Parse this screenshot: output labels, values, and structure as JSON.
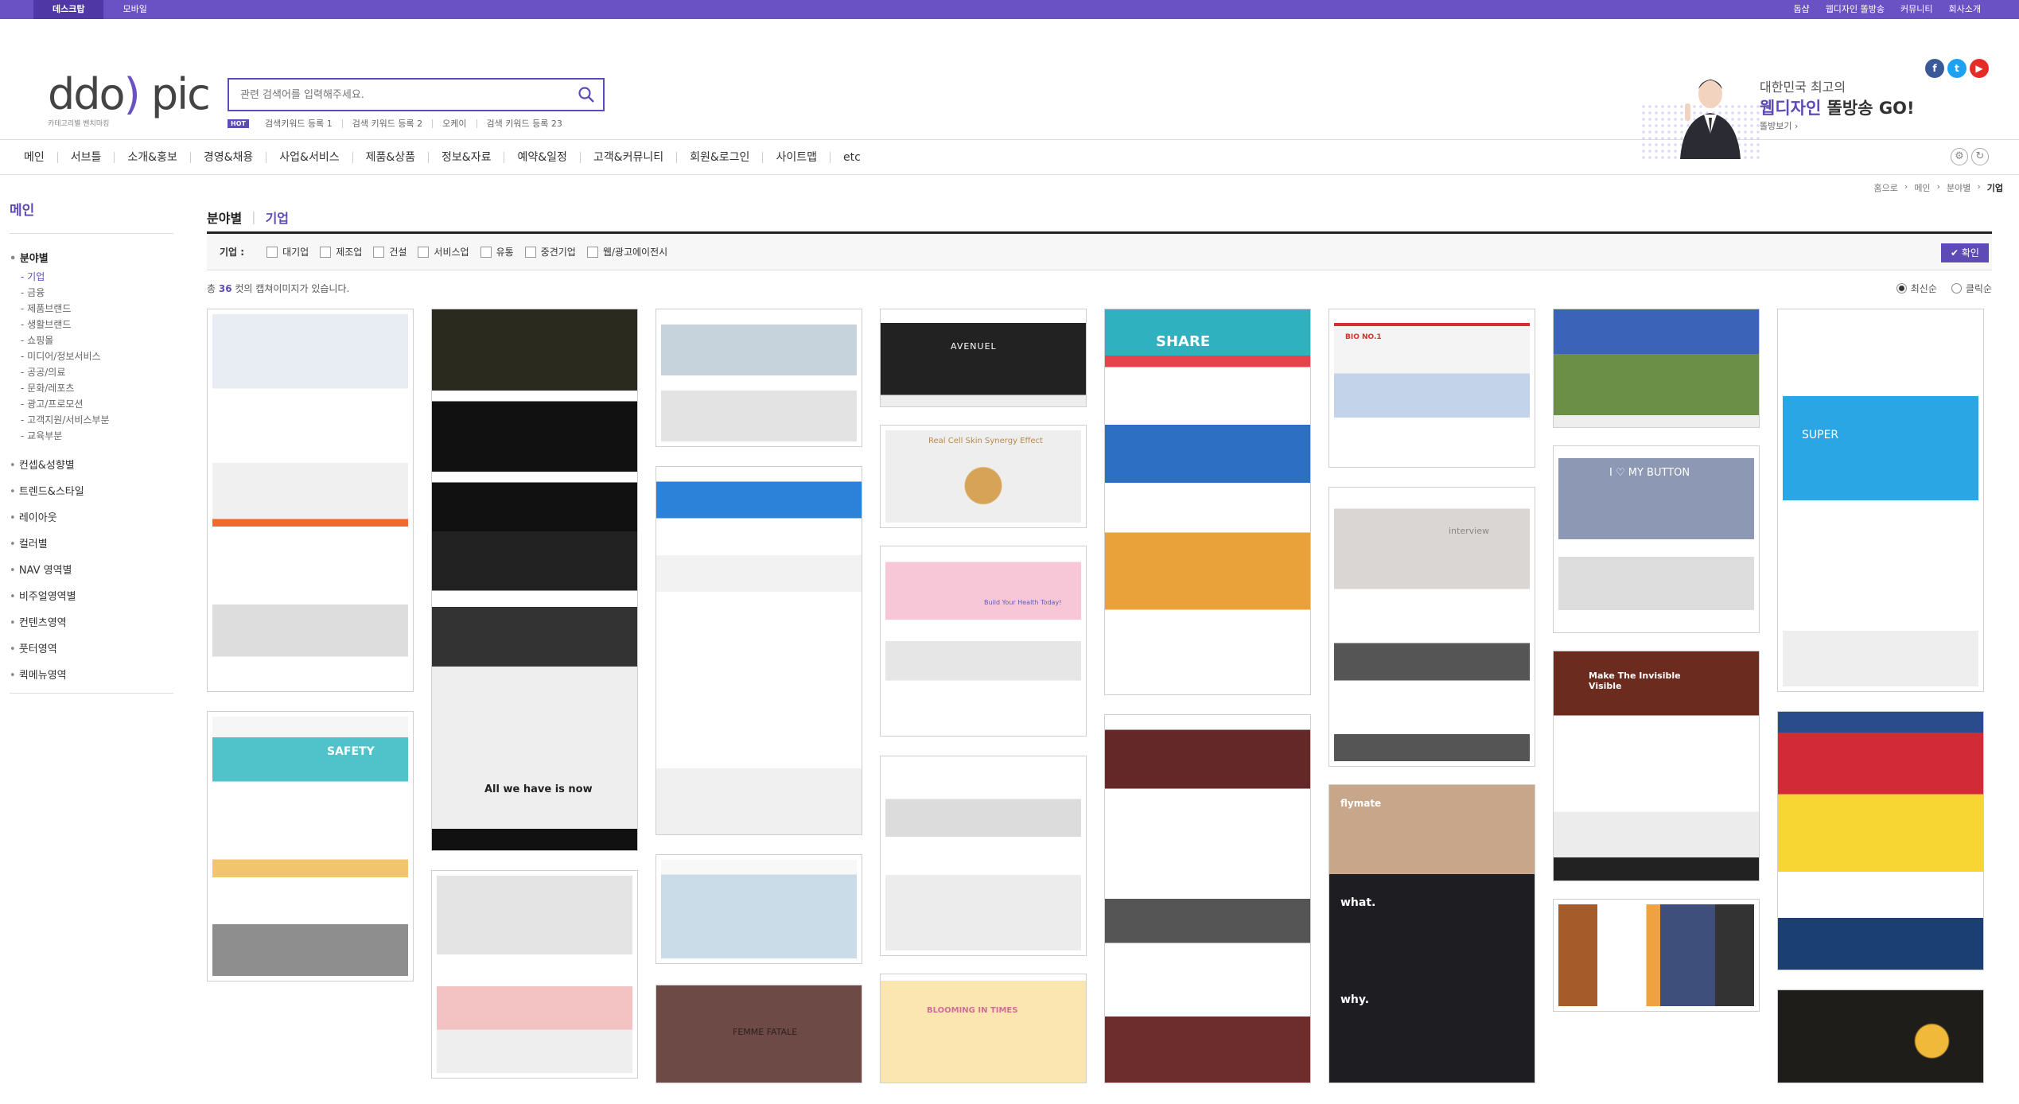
{
  "topbar": {
    "tabs": [
      {
        "label": "데스크탑",
        "active": true
      },
      {
        "label": "모바일",
        "active": false
      }
    ],
    "links": [
      "돕샵",
      "웹디자인 똘방송",
      "커뮤니티",
      "회사소개"
    ]
  },
  "header": {
    "logo_mark_a": "ddo",
    "logo_mark_b": ")",
    "logo_mark_c": "pic",
    "logo_sub": "카테고리별 벤치마킹",
    "search_placeholder": "관련 검색어를 입력해주세요.",
    "hot_label": "HOT",
    "keywords": [
      "검색키워드 등록 1",
      "검색 키워드 등록 2",
      "오케이",
      "검색 키워드 등록 23"
    ],
    "banner": {
      "line1": "대한민국 최고의",
      "line2_highlight": "웹디자인",
      "line2_rest": " 똘방송 GO!",
      "line3": "똘방보기 ›"
    },
    "social": [
      {
        "name": "facebook",
        "glyph": "f",
        "color": "#3b5998"
      },
      {
        "name": "twitter",
        "glyph": "t",
        "color": "#1da1f2"
      },
      {
        "name": "youtube",
        "glyph": "▶",
        "color": "#e52d27"
      }
    ]
  },
  "nav": {
    "items": [
      "메인",
      "서브틀",
      "소개&홍보",
      "경영&채용",
      "사업&서비스",
      "제품&상품",
      "정보&자료",
      "예약&일정",
      "고객&커뮤니티",
      "회원&로그인",
      "사이트맵",
      "etc"
    ]
  },
  "sidebar": {
    "title": "메인",
    "main_category": "분야별",
    "subs": [
      "기업",
      "금융",
      "제품브랜드",
      "생활브랜드",
      "쇼핑몰",
      "미디어/정보서비스",
      "공공/의료",
      "문화/레포츠",
      "광고/프로모션",
      "고객지원/서비스부분",
      "교육부분"
    ],
    "active_sub": "기업",
    "categories": [
      "컨셉&성향별",
      "트렌드&스타일",
      "레이아웃",
      "컬러별",
      "NAV 영역별",
      "비주얼영역별",
      "컨텐츠영역",
      "풋터영역",
      "퀵메뉴영역"
    ]
  },
  "breadcrumb": [
    "홈으로",
    "메인",
    "분야별",
    "기업"
  ],
  "tabs": {
    "first": "분야별",
    "second": "기업"
  },
  "filter": {
    "label": "기업 :",
    "options": [
      "대기업",
      "제조업",
      "건설",
      "서비스업",
      "유통",
      "중견기업",
      "웹/광고에이전시"
    ],
    "confirm": "✔ 확인"
  },
  "count": {
    "prefix": "총 ",
    "number": "36",
    "suffix": " 컷의 캡쳐이미지가 있습니다."
  },
  "sort": [
    "최신순",
    "클릭순"
  ],
  "colors": {
    "accent": "#5f4bb6",
    "topbar": "#6a52c4"
  },
  "thumbnails": {
    "caption_a": "All we have is now",
    "caption_b": "SAFETY",
    "caption_c": "AVENUEL",
    "caption_d": "SHARE",
    "caption_e": "I ♡ MY BUTTON",
    "caption_f": "SUPER",
    "caption_g": "Make The Invisible Visible",
    "caption_h": "what.",
    "caption_i": "why.",
    "caption_j": "BLOOMING IN TIMES",
    "caption_k": "flymate",
    "caption_l": "interview",
    "caption_m": "Real Cell Skin Synergy Effect",
    "caption_n": "FEMME FATALE",
    "caption_o": "BIO NO.1",
    "caption_p": "Build Your Health Today!"
  }
}
